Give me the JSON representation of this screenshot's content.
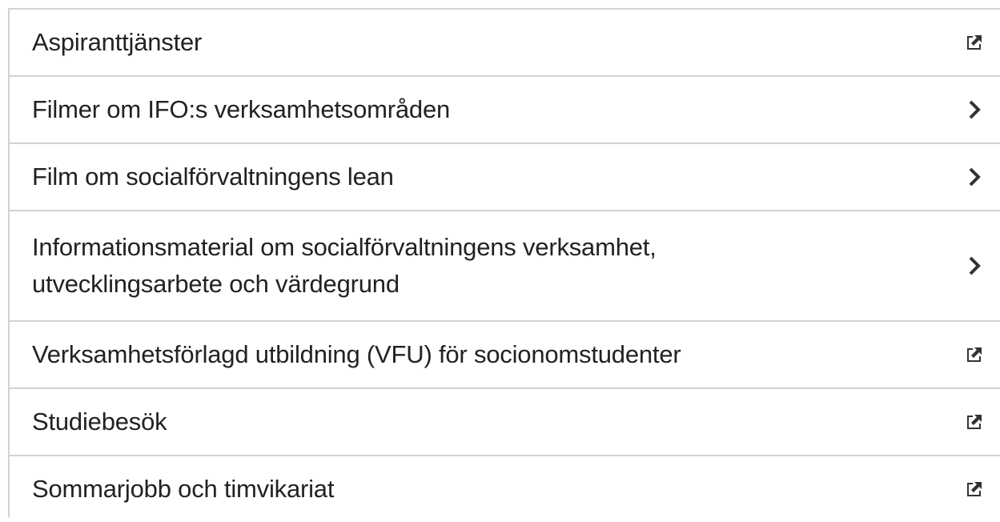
{
  "links": [
    {
      "label": "Aspiranttjänster",
      "icon": "external-link-icon"
    },
    {
      "label": "Filmer om IFO:s verksamhetsområden",
      "icon": "chevron-right-icon"
    },
    {
      "label": "Film om socialförvaltningens lean",
      "icon": "chevron-right-icon"
    },
    {
      "label": "Informationsmaterial om socialförvaltningens verksamhet, utvecklingsarbete och värdegrund",
      "icon": "chevron-right-icon"
    },
    {
      "label": "Verksamhetsförlagd utbildning (VFU) för socionomstudenter",
      "icon": "external-link-icon"
    },
    {
      "label": "Studiebesök",
      "icon": "external-link-icon"
    },
    {
      "label": "Sommarjobb och timvikariat",
      "icon": "external-link-icon"
    }
  ],
  "colors": {
    "text": "#222222",
    "border": "#d2d2d2",
    "icon": "#333333"
  }
}
